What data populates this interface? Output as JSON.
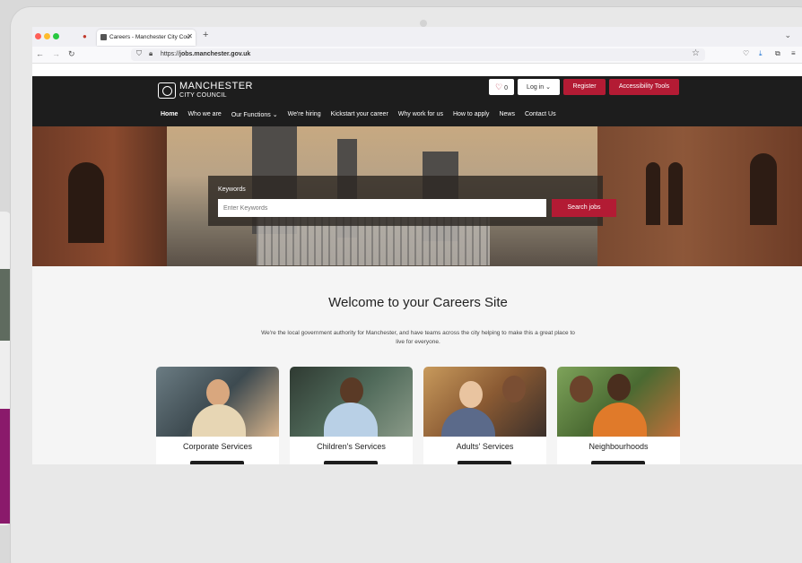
{
  "browser": {
    "tab_title": "Careers - Manchester City Cou",
    "url_prefix": "https://",
    "url_domain": "jobs.manchester.gov.uk"
  },
  "site": {
    "logo_line1": "MANCHESTER",
    "logo_line2": "CITY COUNCIL",
    "favourites_count": "0",
    "login_label": "Log in ⌄",
    "register_label": "Register",
    "accessibility_label": "Accessibility Tools",
    "nav": [
      {
        "label": "Home"
      },
      {
        "label": "Who we are"
      },
      {
        "label": "Our Functions ⌄"
      },
      {
        "label": "We're hiring"
      },
      {
        "label": "Kickstart your career"
      },
      {
        "label": "Why work for us"
      },
      {
        "label": "How to apply"
      },
      {
        "label": "News"
      },
      {
        "label": "Contact Us"
      }
    ]
  },
  "search": {
    "label": "Keywords",
    "placeholder": "Enter Keywords",
    "button": "Search jobs"
  },
  "main": {
    "welcome_title": "Welcome to your Careers Site",
    "intro_text": "We're the local government authority for Manchester, and have teams across the city helping to make this a great place to live for everyone."
  },
  "cards": [
    {
      "title": "Corporate Services"
    },
    {
      "title": "Children's Services"
    },
    {
      "title": "Adults' Services"
    },
    {
      "title": "Neighbourhoods"
    }
  ],
  "colors": {
    "brand_red": "#b31b34",
    "header_dark": "#1d1d1d"
  }
}
